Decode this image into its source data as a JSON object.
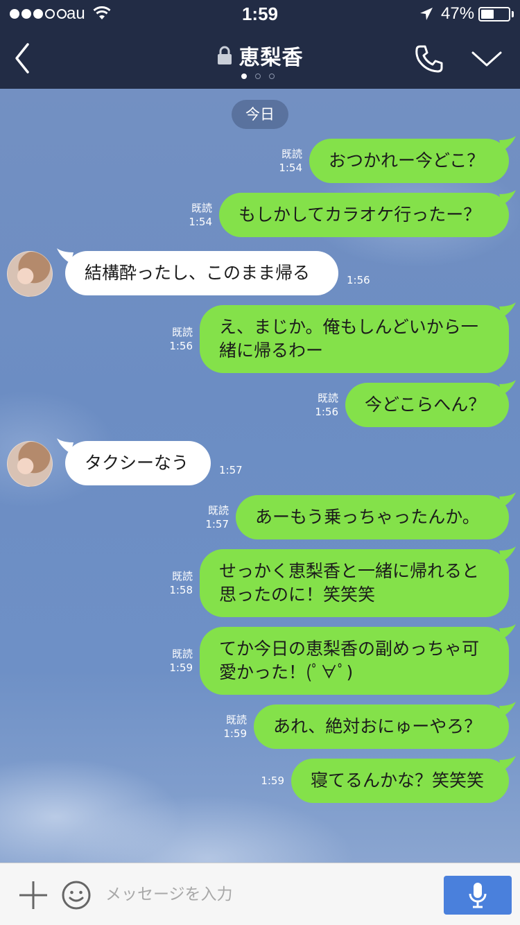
{
  "status_bar": {
    "carrier": "au",
    "time": "1:59",
    "battery_percent": "47%",
    "battery_level": 0.47,
    "signal_bars_filled": 3,
    "signal_bars_total": 5
  },
  "header": {
    "title": "恵梨香",
    "page_dots": 3,
    "active_page": 1,
    "icons": [
      "back-chevron-icon",
      "lock-icon",
      "phone-icon",
      "chevron-down-icon"
    ]
  },
  "chat": {
    "date_separator": "今日",
    "messages": [
      {
        "side": "sent",
        "text": "おつかれー今どこ？",
        "read": "既読",
        "time": "1:54"
      },
      {
        "side": "sent",
        "text": "もしかしてカラオケ行ったー？",
        "read": "既読",
        "time": "1:54"
      },
      {
        "side": "received",
        "text": "結構酔ったし、このまま帰る",
        "read": "",
        "time": "1:56"
      },
      {
        "side": "sent",
        "text": "え、まじか。俺もしんどいから一\n緒に帰るわー",
        "read": "既読",
        "time": "1:56"
      },
      {
        "side": "sent",
        "text": "今どこらへん？",
        "read": "既読",
        "time": "1:56"
      },
      {
        "side": "received",
        "text": "タクシーなう",
        "read": "",
        "time": "1:57"
      },
      {
        "side": "sent",
        "text": "あーもう乗っちゃったんか。",
        "read": "既読",
        "time": "1:57"
      },
      {
        "side": "sent",
        "text": "せっかく恵梨香と一緒に帰れると\n思ったのに！笑笑笑",
        "read": "既読",
        "time": "1:58"
      },
      {
        "side": "sent",
        "text": "てか今日の恵梨香の副めっちゃ可\n愛かった！(ﾟ∀ﾟ)",
        "read": "既読",
        "time": "1:59"
      },
      {
        "side": "sent",
        "text": "あれ、絶対おにゅーやろ？",
        "read": "既読",
        "time": "1:59"
      },
      {
        "side": "sent",
        "text": "寝てるんかな？笑笑笑",
        "read": "",
        "time": "1:59"
      }
    ]
  },
  "input_bar": {
    "placeholder": "メッセージを入力",
    "value": "",
    "icons": [
      "plus-icon",
      "emoji-icon",
      "microphone-icon"
    ]
  },
  "colors": {
    "header_bg": "#222c45",
    "sent_bubble": "#84e14a",
    "received_bubble": "#ffffff",
    "mic_button": "#4a80dc",
    "chat_bg": "#6f8fbf"
  }
}
